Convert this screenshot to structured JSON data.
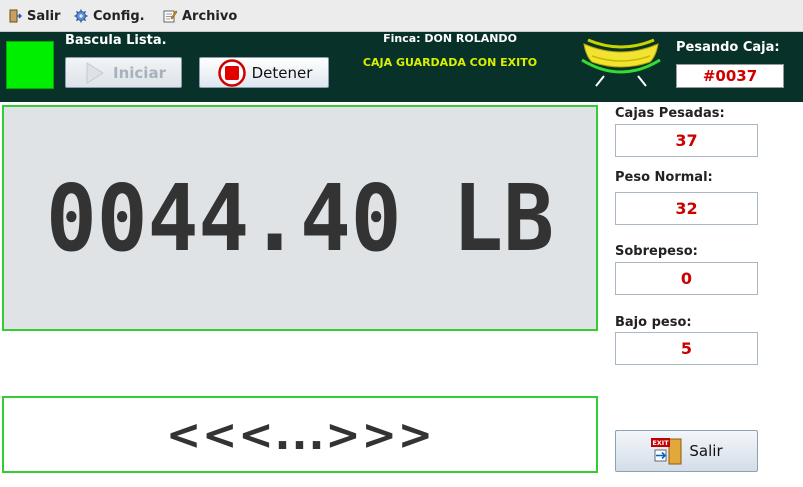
{
  "menu": {
    "salir": "Salir",
    "config": "Config.",
    "archivo": "Archivo"
  },
  "header": {
    "status": "Bascula Lista.",
    "finca": "Finca: DON ROLANDO",
    "message": "CAJA GUARDADA CON EXITO",
    "iniciar_label": "Iniciar",
    "detener_label": "Detener",
    "pesando_label": "Pesando Caja:",
    "pesando_value": "#0037"
  },
  "display": {
    "weight": "0044.40 LB"
  },
  "navigation": {
    "text": "<<<...>>>"
  },
  "stats": {
    "cajas_pesadas_label": "Cajas Pesadas:",
    "cajas_pesadas_value": "37",
    "peso_normal_label": "Peso Normal:",
    "peso_normal_value": "32",
    "sobrepeso_label": "Sobrepeso:",
    "sobrepeso_value": "0",
    "bajo_peso_label": "Bajo peso:",
    "bajo_peso_value": "5"
  },
  "exit_button": {
    "label": "Salir",
    "icon_text": "EXIT"
  },
  "colors": {
    "header_bg": "#083229",
    "led_ok": "#00ee00",
    "panel_border": "#33cc33",
    "value_red": "#cc0000",
    "message_yellow": "#d8f000"
  }
}
